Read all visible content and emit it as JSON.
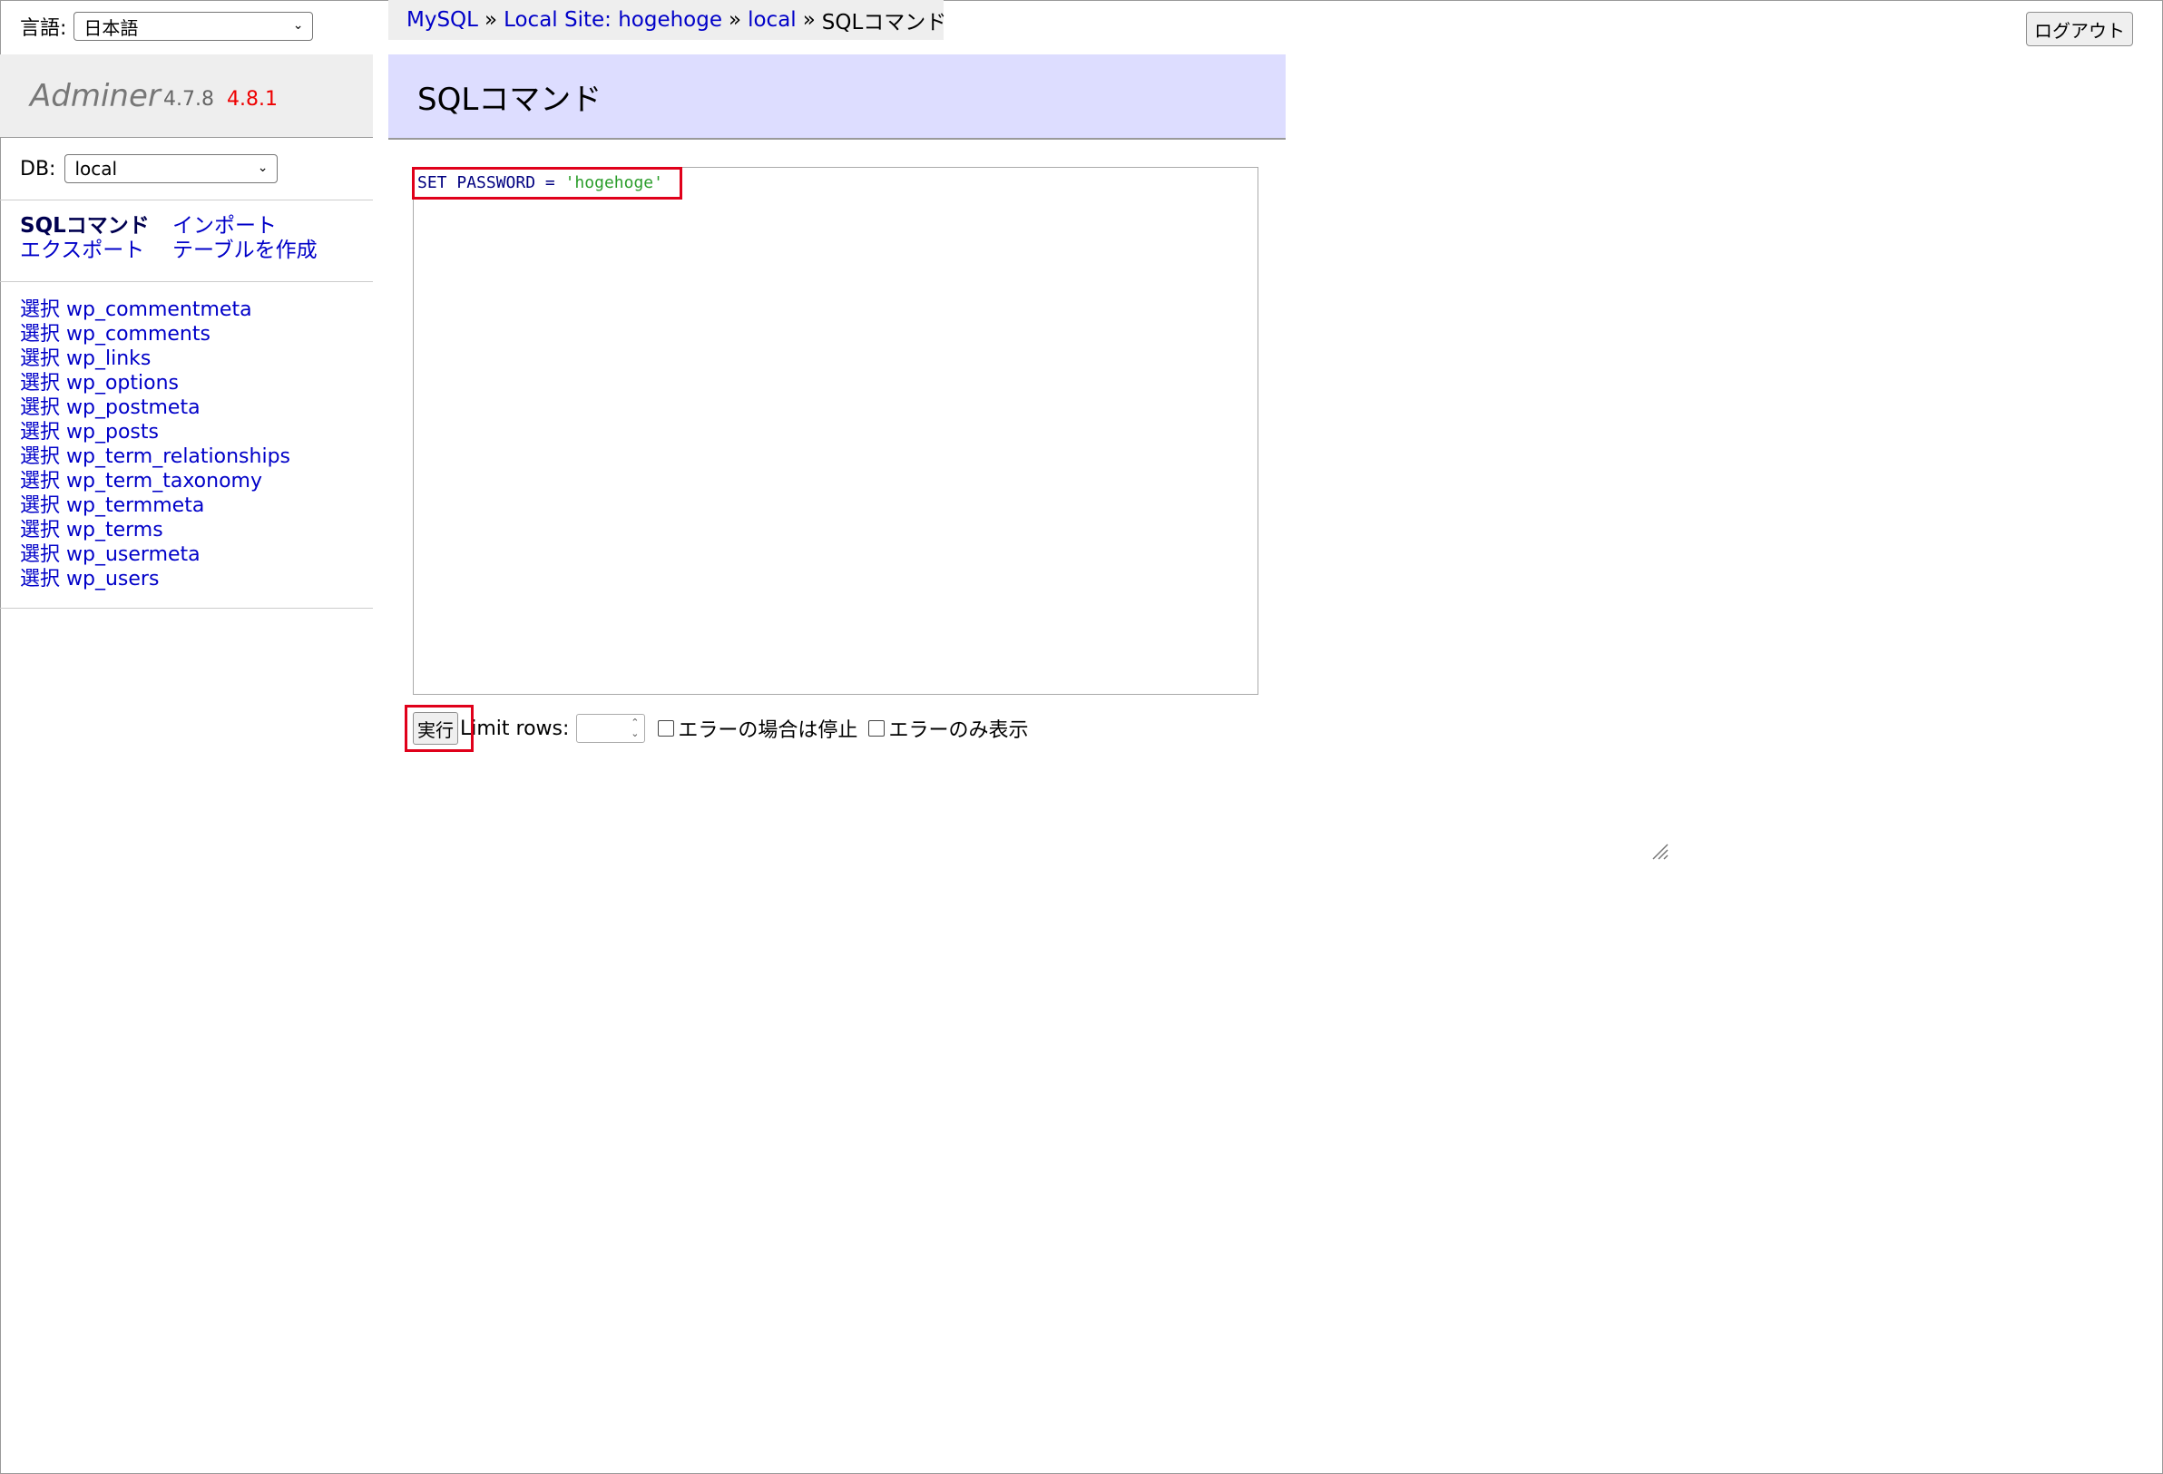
{
  "language": {
    "label": "言語:",
    "selected": "日本語"
  },
  "breadcrumb": {
    "items": [
      "MySQL",
      "Local Site: hogehoge",
      "local"
    ],
    "separator": "»",
    "current": "SQLコマンド"
  },
  "logout_label": "ログアウト",
  "logo": {
    "name": "Adminer",
    "version": "4.7.8",
    "new_version": "4.8.1"
  },
  "db": {
    "label": "DB:",
    "selected": "local"
  },
  "menu": {
    "sql": "SQLコマンド",
    "import": "インポート",
    "export": "エクスポート",
    "create_table": "テーブルを作成"
  },
  "tables": {
    "select_label": "選択",
    "names": [
      "wp_commentmeta",
      "wp_comments",
      "wp_links",
      "wp_options",
      "wp_postmeta",
      "wp_posts",
      "wp_term_relationships",
      "wp_term_taxonomy",
      "wp_termmeta",
      "wp_terms",
      "wp_usermeta",
      "wp_users"
    ]
  },
  "page_title": "SQLコマンド",
  "sql": {
    "keyword1": "SET",
    "keyword2": "PASSWORD",
    "operator": "=",
    "string": "'hogehoge'"
  },
  "controls": {
    "execute_label": "実行",
    "limit_label": "Limit rows:",
    "limit_value": "",
    "stop_on_error": "エラーの場合は停止",
    "show_only_errors": "エラーのみ表示"
  },
  "colors": {
    "highlight": "#e0001a",
    "link": "#0000c8",
    "title_bg": "#ddddff",
    "new_version": "#ee0000"
  }
}
